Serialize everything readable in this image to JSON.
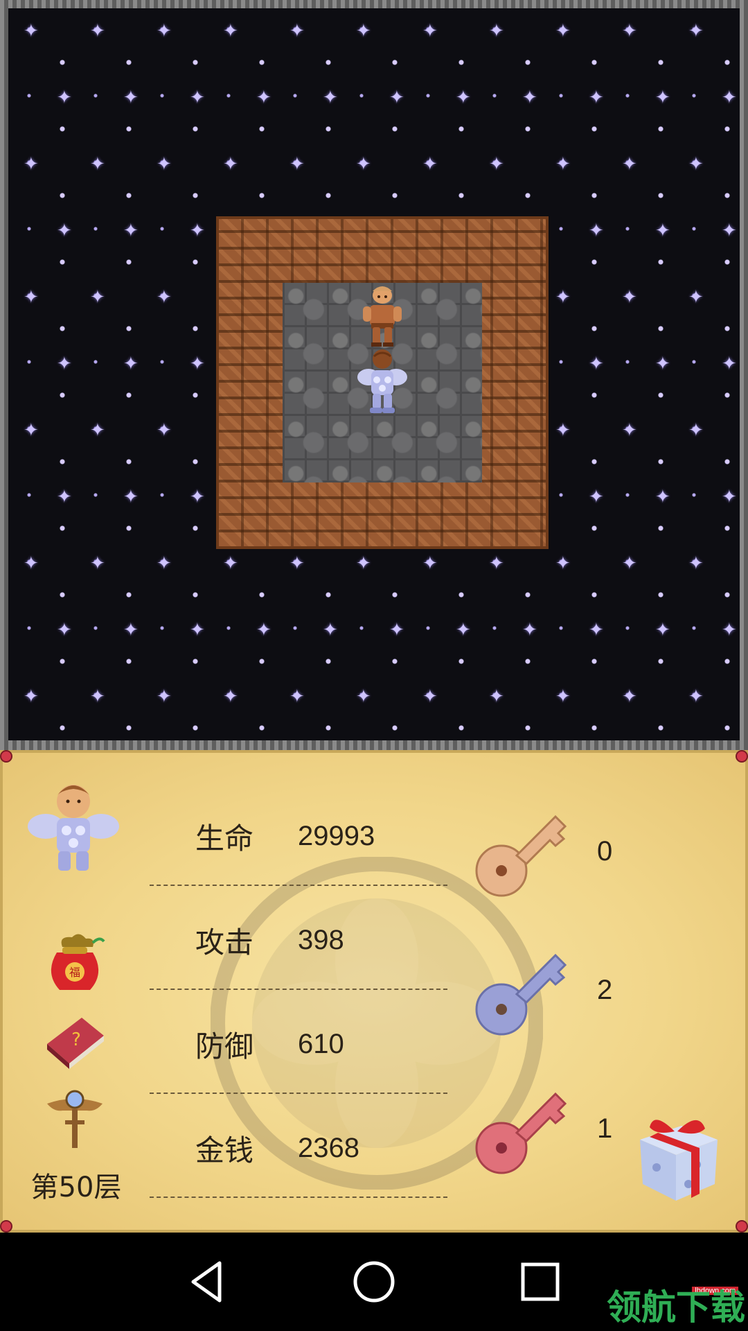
{
  "map": {
    "tiles": {
      "background": "starfield",
      "room_wall": "brick",
      "room_floor": "stone"
    },
    "characters": [
      "npc-warrior",
      "hero-knight"
    ]
  },
  "status": {
    "stats": [
      {
        "label": "生命",
        "value": "29993"
      },
      {
        "label": "攻击",
        "value": "398"
      },
      {
        "label": "防御",
        "value": "610"
      },
      {
        "label": "金钱",
        "value": "2368"
      }
    ],
    "keys": [
      {
        "color": "yellow",
        "hex": "#e8b58c",
        "count": "0"
      },
      {
        "color": "blue",
        "hex": "#9aa0d6",
        "count": "2"
      },
      {
        "color": "red",
        "hex": "#e0707a",
        "count": "1"
      }
    ],
    "floor": "第50层"
  },
  "watermark": {
    "text": "领航下载",
    "sub": "lhdown.com"
  },
  "colors": {
    "panel": "#f1d68a",
    "star": "#cfc4ff",
    "brick": "#9a5a32",
    "stone": "#5a5a5c"
  }
}
